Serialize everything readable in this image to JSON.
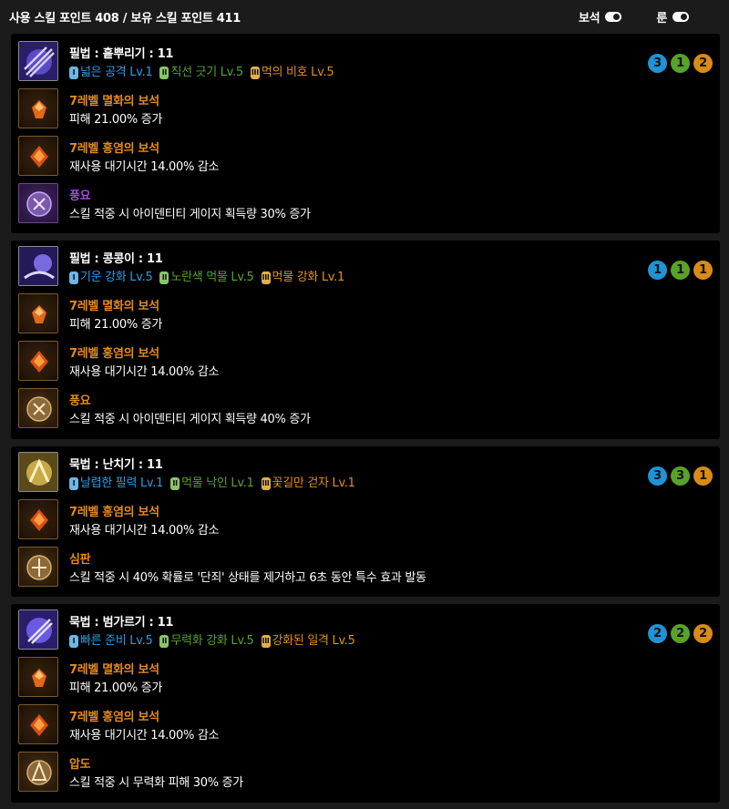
{
  "header": {
    "points_text": "사용 스킬 포인트 408 / 보유 스킬 포인트 411",
    "gem_toggle_label": "보석",
    "rune_toggle_label": "룬"
  },
  "skills": [
    {
      "title": "필법 : 흩뿌리기 : 11",
      "tripods": [
        "넓은 공격 Lv.1",
        "직선 긋기 Lv.5",
        "먹의 비호 Lv.5"
      ],
      "tripod_tiers": [
        "I",
        "II",
        "III"
      ],
      "badges": [
        "3",
        "1",
        "2"
      ],
      "items": [
        {
          "name": "7레벨 멸화의 보석",
          "desc": "피해 21.00% 증가"
        },
        {
          "name": "7레벨 홍염의 보석",
          "desc": "재사용 대기시간 14.00% 감소"
        },
        {
          "name": "풍요",
          "desc": "스킬 적중 시 아이덴티티 게이지 획득량 30% 증가"
        }
      ]
    },
    {
      "title": "필법 : 콩콩이 : 11",
      "tripods": [
        "기운 강화 Lv.5",
        "노란색 먹물 Lv.5",
        "먹물 강화 Lv.1"
      ],
      "tripod_tiers": [
        "I",
        "II",
        "III"
      ],
      "badges": [
        "1",
        "1",
        "1"
      ],
      "items": [
        {
          "name": "7레벨 멸화의 보석",
          "desc": "피해 21.00% 증가"
        },
        {
          "name": "7레벨 홍염의 보석",
          "desc": "재사용 대기시간 14.00% 감소"
        },
        {
          "name": "풍요",
          "desc": "스킬 적중 시 아이덴티티 게이지 획득량 40% 증가"
        }
      ]
    },
    {
      "title": "묵법 : 난치기 : 11",
      "tripods": [
        "날렵한 필력 Lv.1",
        "먹물 낙인 Lv.1",
        "꽃길만 걷자 Lv.1"
      ],
      "tripod_tiers": [
        "I",
        "II",
        "III"
      ],
      "badges": [
        "3",
        "3",
        "1"
      ],
      "items": [
        {
          "name": "7레벨 홍염의 보석",
          "desc": "재사용 대기시간 14.00% 감소"
        },
        {
          "name": "심판",
          "desc": "스킬 적중 시 40% 확률로 '단죄' 상태를 제거하고 6초 동안 특수 효과 발동"
        }
      ]
    },
    {
      "title": "묵법 : 범가르기 : 11",
      "tripods": [
        "빠른 준비 Lv.5",
        "무력화 강화 Lv.5",
        "강화된 일격 Lv.5"
      ],
      "tripod_tiers": [
        "I",
        "II",
        "III"
      ],
      "badges": [
        "2",
        "2",
        "2"
      ],
      "items": [
        {
          "name": "7레벨 멸화의 보석",
          "desc": "피해 21.00% 증가"
        },
        {
          "name": "7레벨 홍염의 보석",
          "desc": "재사용 대기시간 14.00% 감소"
        },
        {
          "name": "압도",
          "desc": "스킬 적중 시 무력화 피해 30% 증가"
        }
      ]
    }
  ]
}
